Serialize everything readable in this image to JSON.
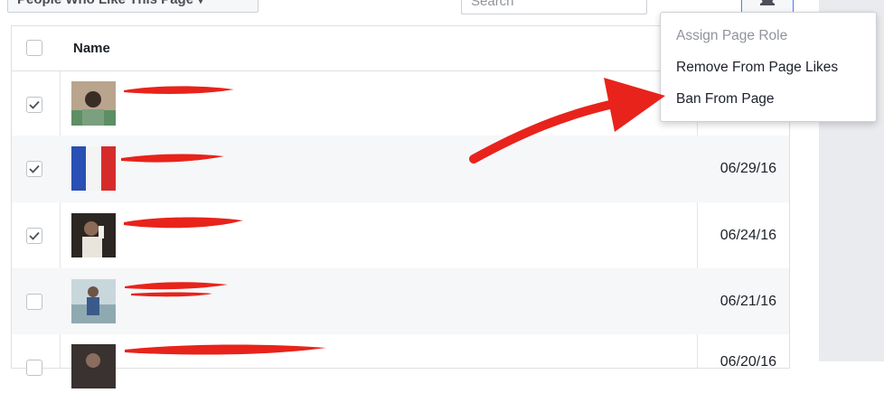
{
  "toolbar": {
    "filter_label": "People Who Like This Page ▾",
    "search_placeholder": "Search"
  },
  "table": {
    "header": {
      "name": "Name"
    },
    "rows": [
      {
        "checked": true,
        "date": ""
      },
      {
        "checked": true,
        "date": "06/29/16"
      },
      {
        "checked": true,
        "date": "06/24/16"
      },
      {
        "checked": false,
        "date": "06/21/16"
      },
      {
        "checked": false,
        "date": "06/20/16"
      }
    ]
  },
  "menu": {
    "items": [
      {
        "label": "Assign Page Role",
        "disabled": true
      },
      {
        "label": "Remove From Page Likes",
        "disabled": false
      },
      {
        "label": "Ban From Page",
        "disabled": false
      }
    ]
  },
  "annotation": {
    "arrow_color": "#e8231b",
    "redaction_color": "#e8231b"
  },
  "icons": {
    "gear": "gear-icon",
    "check": "check-icon"
  }
}
